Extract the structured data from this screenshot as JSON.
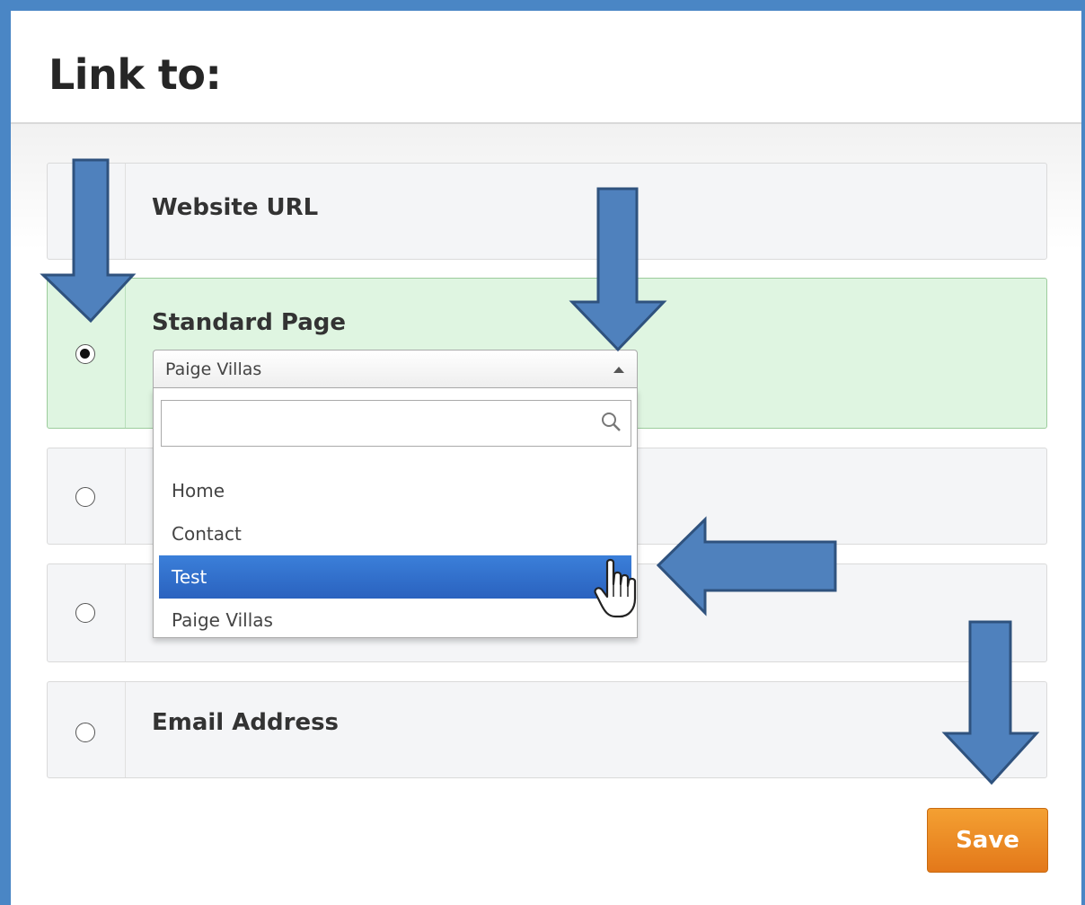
{
  "dialog": {
    "title": "Link to:"
  },
  "options": [
    {
      "label": "Website URL",
      "selected": false
    },
    {
      "label": "Standard Page",
      "selected": true
    },
    {
      "label": "",
      "selected": false
    },
    {
      "label": "",
      "selected": false
    },
    {
      "label": "Email Address",
      "selected": false
    }
  ],
  "page_select": {
    "value": "Paige Villas",
    "search_value": "",
    "items": [
      "Home",
      "Contact",
      "Test",
      "Paige Villas"
    ],
    "highlighted": "Test"
  },
  "save_label": "Save",
  "colors": {
    "annotation_arrow": "#4f81bd",
    "selected_option": "#dff5e1",
    "highlight": "#2f6fcd",
    "save_button": "#ee8a26"
  },
  "icons": [
    "search-icon",
    "hand-cursor-icon",
    "arrow-down-icon",
    "arrow-left-icon"
  ]
}
